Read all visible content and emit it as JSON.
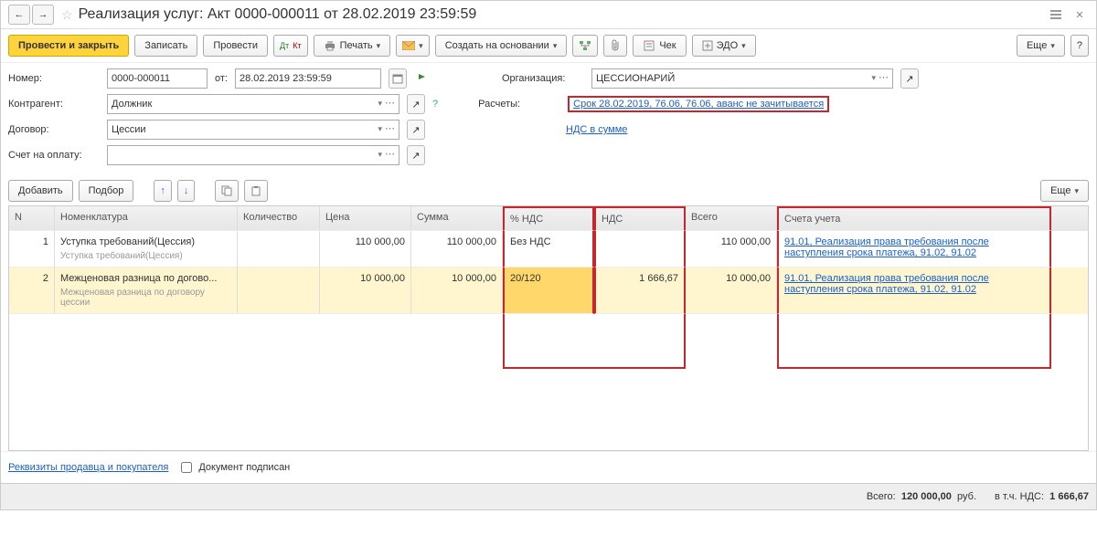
{
  "title": "Реализация услуг: Акт 0000-000011 от 28.02.2019 23:59:59",
  "toolbar": {
    "post_close": "Провести и закрыть",
    "write": "Записать",
    "post": "Провести",
    "print": "Печать",
    "create_based": "Создать на основании",
    "check": "Чек",
    "edo": "ЭДО",
    "more": "Еще"
  },
  "fields": {
    "number_lbl": "Номер:",
    "number_val": "0000-000011",
    "from_lbl": "от:",
    "date_val": "28.02.2019 23:59:59",
    "org_lbl": "Организация:",
    "org_val": "ЦЕССИОНАРИЙ",
    "cp_lbl": "Контрагент:",
    "cp_val": "Должник",
    "settle_lbl": "Расчеты:",
    "settle_link": "Срок 28.02.2019, 76.06, 76.06, аванс не зачитывается",
    "contract_lbl": "Договор:",
    "contract_val": "Цессии",
    "vat_link": "НДС в сумме",
    "bill_lbl": "Счет на оплату:"
  },
  "sub_tb": {
    "add": "Добавить",
    "pick": "Подбор",
    "more": "Еще"
  },
  "cols": {
    "n": "N",
    "nom": "Номенклатура",
    "qty": "Количество",
    "price": "Цена",
    "sum": "Сумма",
    "vat_pct": "% НДС",
    "vat": "НДС",
    "total": "Всего",
    "acc": "Счета учета"
  },
  "rows": [
    {
      "n": "1",
      "nom": "Уступка требований(Цессия)",
      "sub": "Уступка требований(Цессия)",
      "price": "110 000,00",
      "sum": "110 000,00",
      "vat_pct": "Без НДС",
      "vat": "",
      "total": "110 000,00",
      "acc": "91.01, Реализация права требования после наступления срока платежа, 91.02, 91.02"
    },
    {
      "n": "2",
      "nom": "Межценовая разница по догово...",
      "sub": "Межценовая разница по договору цессии",
      "price": "10 000,00",
      "sum": "10 000,00",
      "vat_pct": "20/120",
      "vat": "1 666,67",
      "total": "10 000,00",
      "acc": "91.01, Реализация права требования после наступления срока платежа, 91.02, 91.02"
    }
  ],
  "footer": {
    "req_link": "Реквизиты продавца и покупателя",
    "signed": "Документ подписан",
    "total_lbl": "Всего:",
    "total": "120 000,00",
    "cur": "руб.",
    "vat_lbl": "в т.ч. НДС:",
    "vat": "1 666,67"
  }
}
